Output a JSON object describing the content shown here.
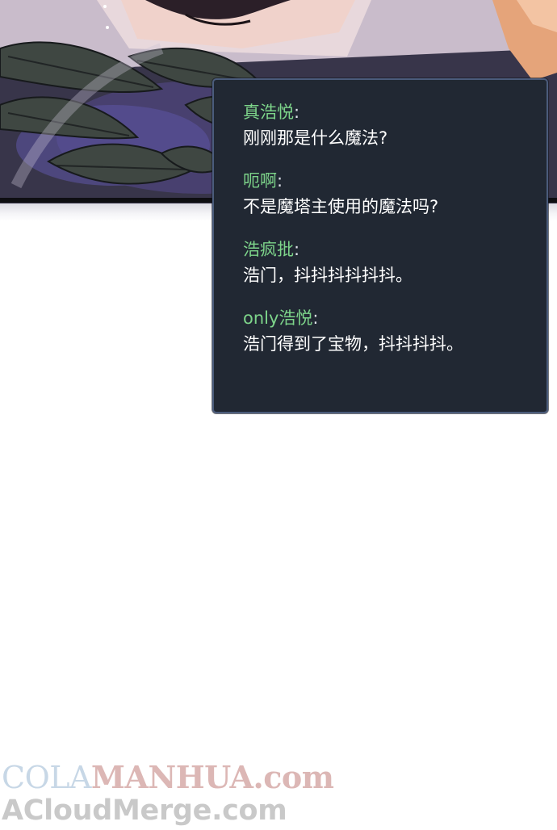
{
  "comments": [
    {
      "user": "真浩悦",
      "text": "刚刚那是什么魔法?"
    },
    {
      "user": "呃啊",
      "text": "不是魔塔主使用的魔法吗?"
    },
    {
      "user": "浩疯批",
      "text": "浩门，抖抖抖抖抖抖。"
    },
    {
      "user": "only浩悦",
      "text": "浩门得到了宝物，抖抖抖抖。"
    }
  ],
  "colon": ":",
  "watermark": {
    "line1_part1": "COLA",
    "line1_part2": "MANHUA.com",
    "line2": "ACloudMerge.com"
  },
  "colors": {
    "username": "#7dd48a",
    "comment_text": "#ffffff",
    "box_background": "#212833",
    "box_border": "#4b5c7c"
  }
}
